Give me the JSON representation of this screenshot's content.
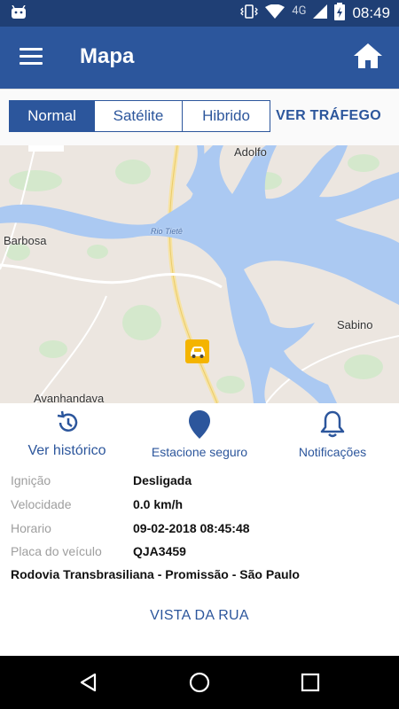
{
  "status_bar": {
    "time": "08:49",
    "network": "4G"
  },
  "app_bar": {
    "title": "Mapa"
  },
  "map_types": {
    "tabs": [
      "Normal",
      "Satélite",
      "Hibrido"
    ],
    "selected": "Normal",
    "traffic_label": "VER TRÁFEGO"
  },
  "map": {
    "labels": {
      "adolfo": "Adolfo",
      "barbosa": "Barbosa",
      "sabino": "Sabino",
      "avanhandava": "Avanhandava",
      "river": "Rio Tietê"
    }
  },
  "actions": {
    "history": "Ver histórico",
    "safe_parking": "Estacione seguro",
    "notifications": "Notificações"
  },
  "vehicle": {
    "ignition_label": "Ignição",
    "ignition_value": "Desligada",
    "speed_label": "Velocidade",
    "speed_value": "0.0 km/h",
    "time_label": "Horario",
    "time_value": "09-02-2018 08:45:48",
    "plate_label": "Placa do veículo",
    "plate_value": "QJA3459",
    "address": "Rodovia Transbrasiliana - Promissão - São Paulo"
  },
  "street_view_label": "VISTA DA RUA",
  "colors": {
    "primary": "#2c569c",
    "status_bar": "#1f3f75",
    "water": "#abc9f2",
    "vehicle_marker": "#f4b400"
  }
}
